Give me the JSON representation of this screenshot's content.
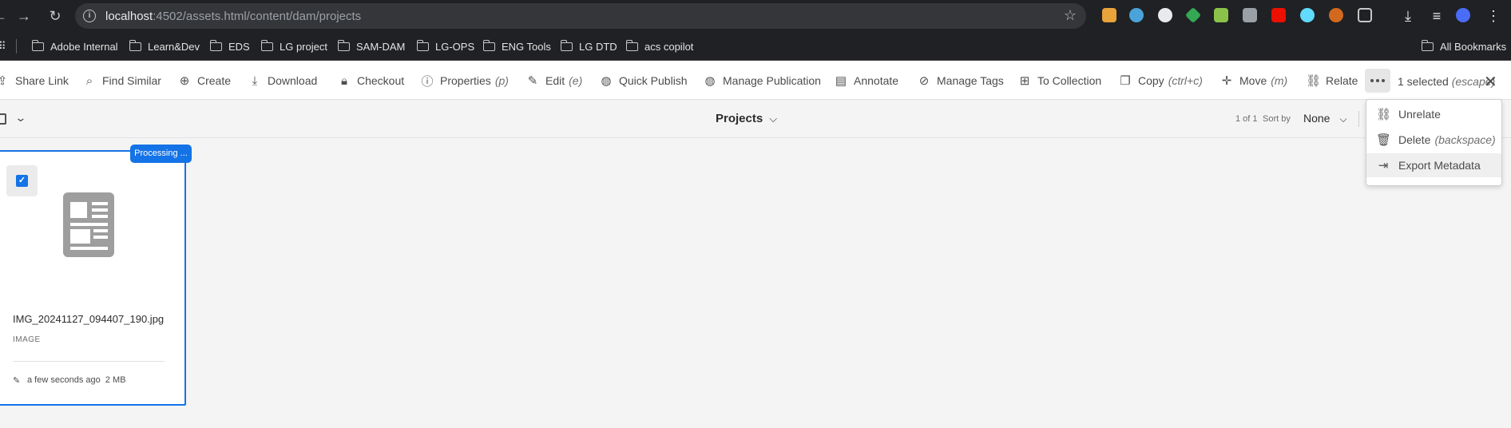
{
  "browser": {
    "url_host": "localhost",
    "url_rest": ":4502/assets.html/content/dam/projects",
    "bookmarks": [
      "Adobe Internal",
      "Learn&Dev",
      "EDS",
      "LG project",
      "SAM-DAM",
      "LG-OPS",
      "ENG Tools",
      "LG DTD",
      "acs copilot"
    ],
    "all_bookmarks": "All Bookmarks"
  },
  "actionbar": {
    "items": [
      {
        "label": "Share Link",
        "shortcut": "",
        "icon": "share-icon"
      },
      {
        "label": "Find Similar",
        "shortcut": "",
        "icon": "find-similar-icon"
      },
      {
        "label": "Create",
        "shortcut": "",
        "icon": "plus-circle-icon"
      },
      {
        "label": "Download",
        "shortcut": "",
        "icon": "download-icon"
      },
      {
        "label": "Checkout",
        "shortcut": "",
        "icon": "lock-icon"
      },
      {
        "label": "Properties",
        "shortcut": "(p)",
        "icon": "info-icon"
      },
      {
        "label": "Edit",
        "shortcut": "(e)",
        "icon": "pencil-icon"
      },
      {
        "label": "Quick Publish",
        "shortcut": "",
        "icon": "globe-icon"
      },
      {
        "label": "Manage Publication",
        "shortcut": "",
        "icon": "globe-gear-icon"
      },
      {
        "label": "Annotate",
        "shortcut": "",
        "icon": "comment-icon"
      },
      {
        "label": "Manage Tags",
        "shortcut": "",
        "icon": "tag-icon"
      },
      {
        "label": "To Collection",
        "shortcut": "",
        "icon": "collection-icon"
      },
      {
        "label": "Copy",
        "shortcut": "(ctrl+c)",
        "icon": "copy-icon"
      },
      {
        "label": "Move",
        "shortcut": "(m)",
        "icon": "move-icon"
      },
      {
        "label": "Relate",
        "shortcut": "",
        "icon": "link-icon"
      }
    ],
    "selected_text": "1 selected",
    "selected_hint": "(escape)"
  },
  "subbar": {
    "title": "Projects",
    "count": "1 of 1",
    "sort_label": "Sort by",
    "sort_value": "None"
  },
  "card": {
    "badge": "Processing ...",
    "file_name": "IMG_20241127_094407_190.jpg",
    "file_type": "IMAGE",
    "modified": "a few seconds ago",
    "size": "2 MB"
  },
  "menu": {
    "items": [
      {
        "label": "Unrelate",
        "shortcut": "",
        "icon": "unlink-icon"
      },
      {
        "label": "Delete",
        "shortcut": "(backspace)",
        "icon": "trash-icon"
      },
      {
        "label": "Export Metadata",
        "shortcut": "",
        "icon": "export-icon"
      }
    ]
  }
}
